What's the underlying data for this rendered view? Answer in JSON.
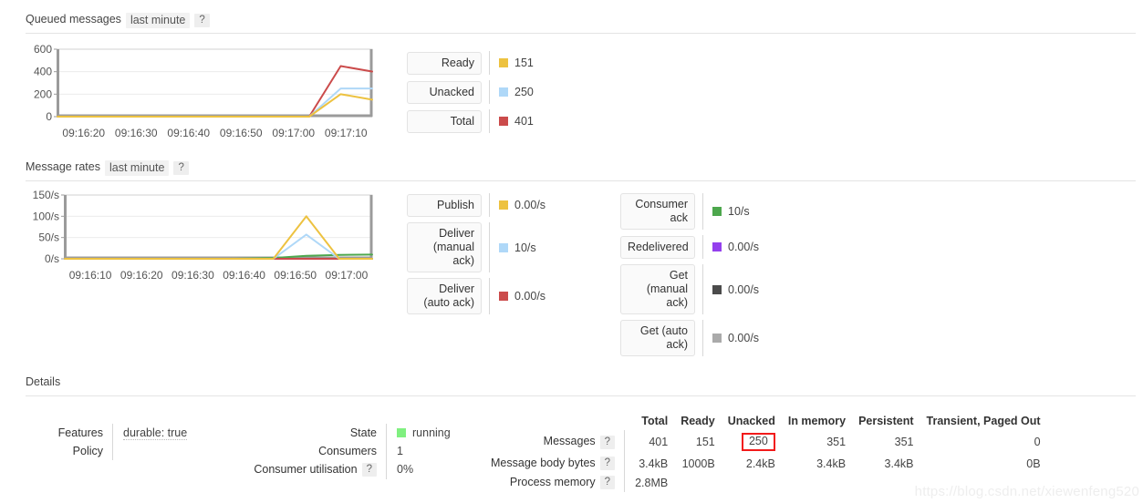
{
  "queued": {
    "title": "Queued messages",
    "period": "last minute",
    "help": "?",
    "legend": [
      {
        "label": "Ready",
        "value": "151",
        "color": "#edc240"
      },
      {
        "label": "Unacked",
        "value": "250",
        "color": "#afd8f8"
      },
      {
        "label": "Total",
        "value": "401",
        "color": "#cb4b4b"
      }
    ],
    "chart_data": {
      "type": "line",
      "title": "Queued messages",
      "xlabel": "",
      "ylabel": "",
      "ylim": [
        0,
        600
      ],
      "yticks": [
        0,
        200,
        400,
        600
      ],
      "ytick_labels": [
        "0",
        "200",
        "400",
        "600"
      ],
      "xtick_labels": [
        "09:16:20",
        "09:16:30",
        "09:16:40",
        "09:16:50",
        "09:17:00",
        "09:17:10"
      ],
      "grid": true,
      "legend_position": "right",
      "x": [
        0,
        10,
        20,
        30,
        40,
        45,
        50
      ],
      "series": [
        {
          "name": "Ready",
          "color": "#edc240",
          "values": [
            0,
            0,
            0,
            0,
            0,
            200,
            151
          ]
        },
        {
          "name": "Unacked",
          "color": "#afd8f8",
          "values": [
            0,
            0,
            0,
            0,
            0,
            250,
            250
          ]
        },
        {
          "name": "Total",
          "color": "#cb4b4b",
          "values": [
            0,
            0,
            0,
            0,
            0,
            450,
            401
          ]
        }
      ]
    }
  },
  "rates": {
    "title": "Message rates",
    "period": "last minute",
    "help": "?",
    "legend_left": [
      {
        "label": "Publish",
        "value": "0.00/s",
        "color": "#edc240"
      },
      {
        "label": "Deliver (manual ack)",
        "value": "10/s",
        "color": "#afd8f8"
      },
      {
        "label": "Deliver (auto ack)",
        "value": "0.00/s",
        "color": "#cb4b4b"
      }
    ],
    "legend_right": [
      {
        "label": "Consumer ack",
        "value": "10/s",
        "color": "#4da74d"
      },
      {
        "label": "Redelivered",
        "value": "0.00/s",
        "color": "#9440ed"
      },
      {
        "label": "Get (manual ack)",
        "value": "0.00/s",
        "color": "#4b4b4b"
      },
      {
        "label": "Get (auto ack)",
        "value": "0.00/s",
        "color": "#aaaaaa"
      }
    ],
    "chart_data": {
      "type": "line",
      "title": "Message rates",
      "xlabel": "",
      "ylabel": "",
      "ylim": [
        0,
        150
      ],
      "yticks": [
        0,
        50,
        100,
        150
      ],
      "ytick_labels": [
        "0/s",
        "50/s",
        "100/s",
        "150/s"
      ],
      "xtick_labels": [
        "09:16:10",
        "09:16:20",
        "09:16:30",
        "09:16:40",
        "09:16:50",
        "09:17:00"
      ],
      "grid": true,
      "legend_position": "right",
      "x": [
        0,
        10,
        20,
        30,
        38,
        44,
        50,
        56
      ],
      "series": [
        {
          "name": "Publish",
          "color": "#edc240",
          "values": [
            0,
            0,
            0,
            0,
            0,
            100,
            0,
            0
          ]
        },
        {
          "name": "Deliver (manual ack)",
          "color": "#afd8f8",
          "values": [
            0,
            0,
            0,
            0,
            0,
            57,
            0,
            0
          ]
        },
        {
          "name": "Deliver (auto ack)",
          "color": "#cb4b4b",
          "values": [
            0,
            0,
            0,
            0,
            0,
            0,
            0,
            0
          ]
        },
        {
          "name": "Consumer ack",
          "color": "#4da74d",
          "values": [
            0,
            0,
            0,
            0,
            2,
            7,
            9,
            10
          ]
        },
        {
          "name": "Redelivered",
          "color": "#9440ed",
          "values": [
            0,
            0,
            0,
            0,
            0,
            0,
            0,
            0
          ]
        },
        {
          "name": "Get (manual ack)",
          "color": "#4b4b4b",
          "values": [
            0,
            0,
            0,
            0,
            0,
            0,
            0,
            0
          ]
        },
        {
          "name": "Get (auto ack)",
          "color": "#aaaaaa",
          "values": [
            0,
            0,
            0,
            0,
            0,
            0,
            0,
            0
          ]
        }
      ]
    }
  },
  "details": {
    "title": "Details",
    "left": {
      "features_label": "Features",
      "features_value": "durable: true",
      "policy_label": "Policy",
      "policy_value": ""
    },
    "middle": {
      "state_label": "State",
      "state_value": "running",
      "state_color": "#80f080",
      "consumers_label": "Consumers",
      "consumers_value": "1",
      "utilisation_label": "Consumer utilisation",
      "utilisation_help": "?",
      "utilisation_value": "0%"
    },
    "table": {
      "row_labels": [
        {
          "label": "Messages",
          "help": "?"
        },
        {
          "label": "Message body bytes",
          "help": "?"
        },
        {
          "label": "Process memory",
          "help": "?"
        }
      ],
      "columns": [
        "Total",
        "Ready",
        "Unacked",
        "In memory",
        "Persistent",
        "Transient, Paged Out"
      ],
      "rows": [
        [
          "401",
          "151",
          "250",
          "351",
          "351",
          "0"
        ],
        [
          "3.4kB",
          "1000B",
          "2.4kB",
          "3.4kB",
          "3.4kB",
          "0B"
        ],
        [
          "2.8MB",
          "",
          "",
          "",
          "",
          ""
        ]
      ],
      "highlight": {
        "row": 0,
        "col": 2,
        "color": "#f21a1a"
      }
    }
  },
  "watermark": "https://blog.csdn.net/xiewenfeng520"
}
